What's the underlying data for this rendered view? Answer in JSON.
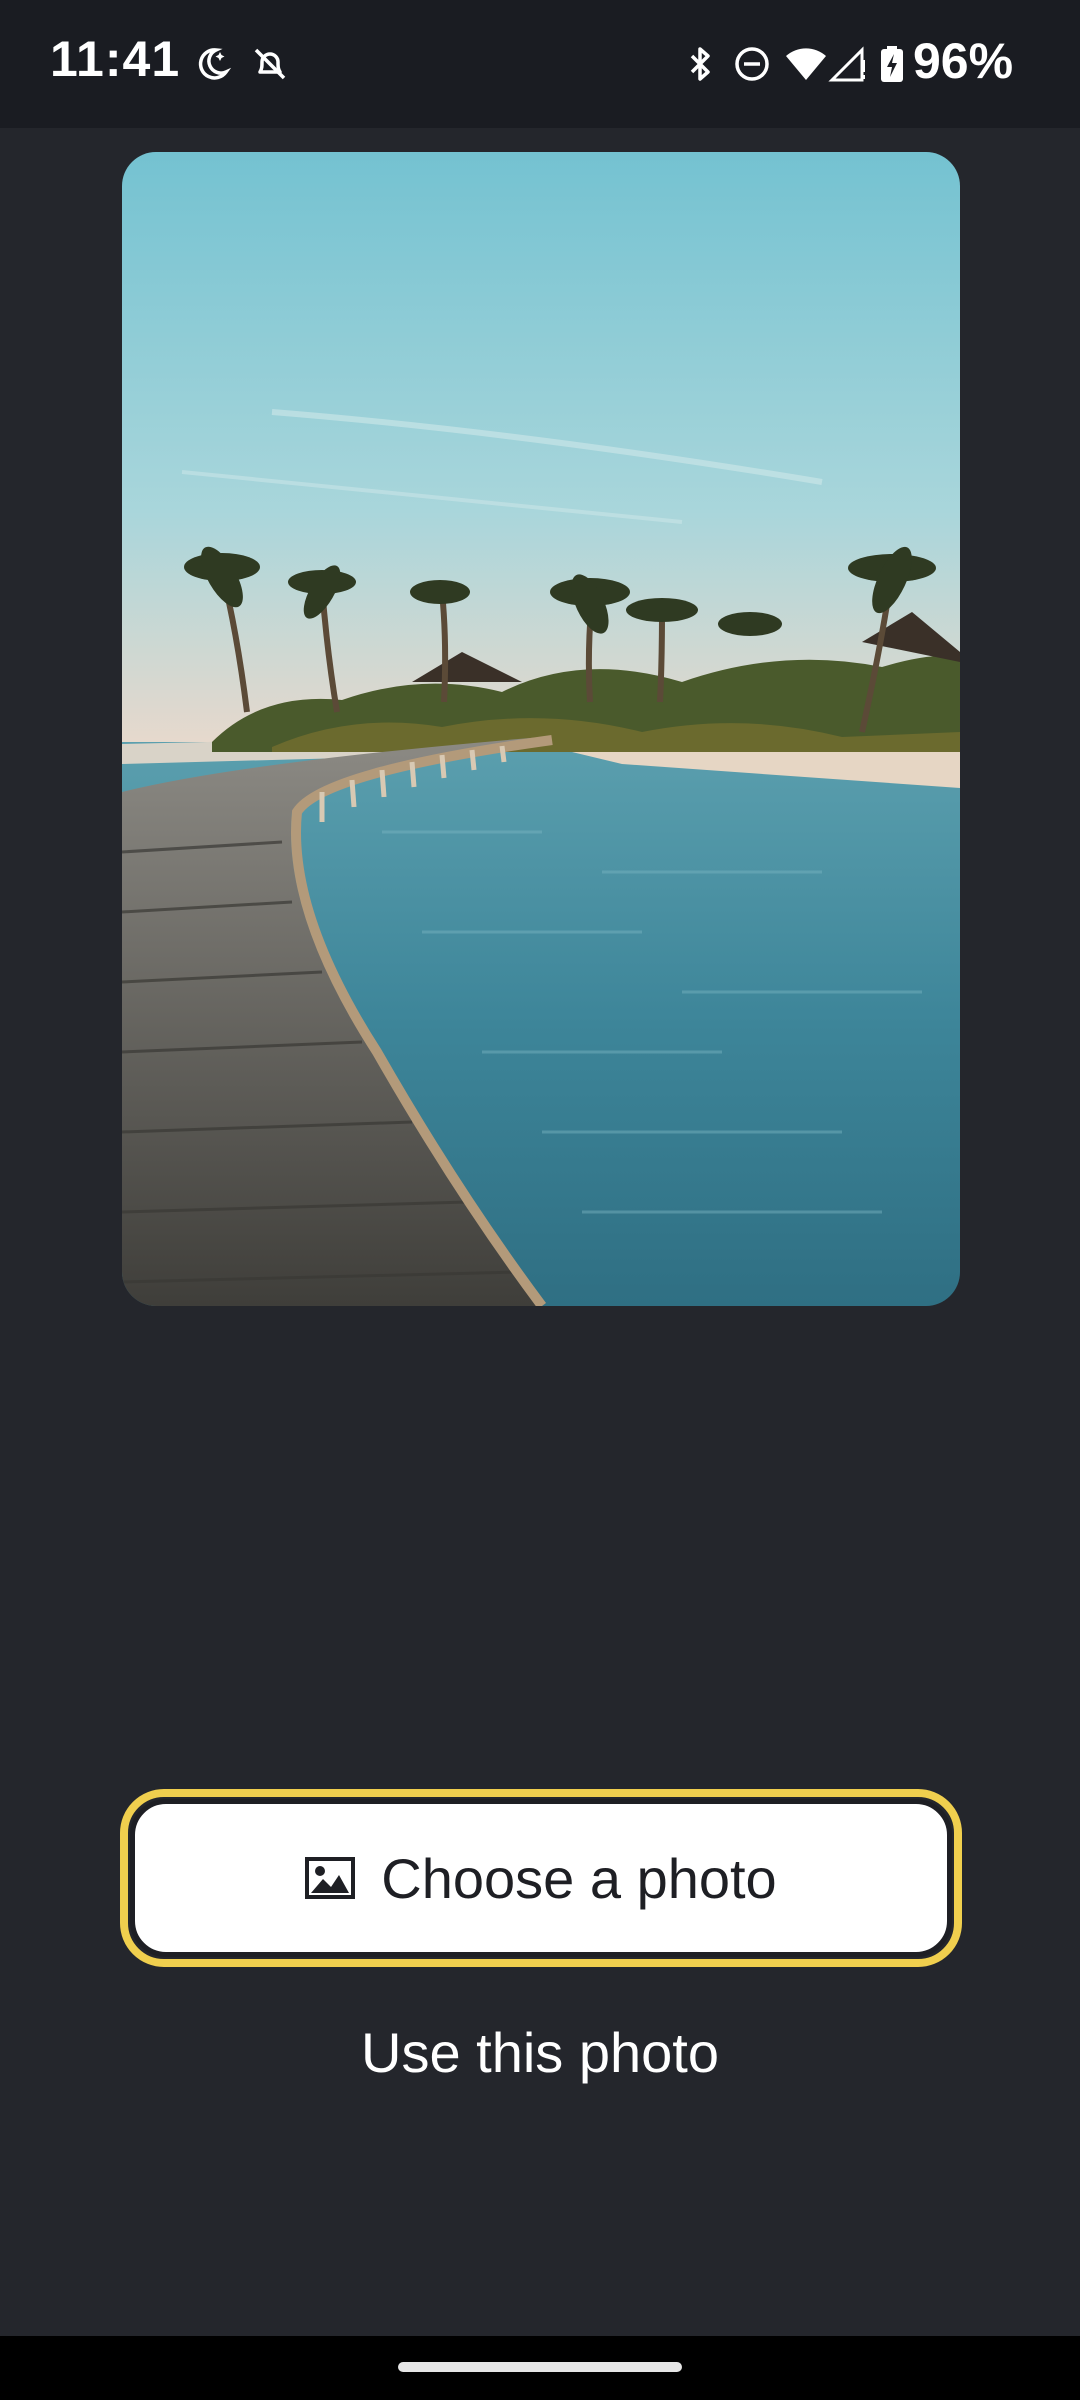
{
  "status_bar": {
    "time": "11:41",
    "battery": "96%",
    "icons": [
      "moon-bedtime-icon",
      "alarm-off-icon",
      "bluetooth-icon",
      "do-not-disturb-icon",
      "wifi-icon",
      "cellular-signal-icon",
      "battery-charging-icon"
    ]
  },
  "photo": {
    "icon": "beach-boardwalk-photo",
    "colors": {
      "sky_top": "#74c2d1",
      "sky_bottom": "#e9d9cc",
      "water": "#3d8599",
      "deck": "#5a5a55"
    }
  },
  "actions": {
    "choose_label": "Choose a photo",
    "choose_icon": "image-icon",
    "use_label": "Use this photo"
  },
  "theme": {
    "background": "#24262c",
    "focus_ring": "#f0cf4e"
  }
}
